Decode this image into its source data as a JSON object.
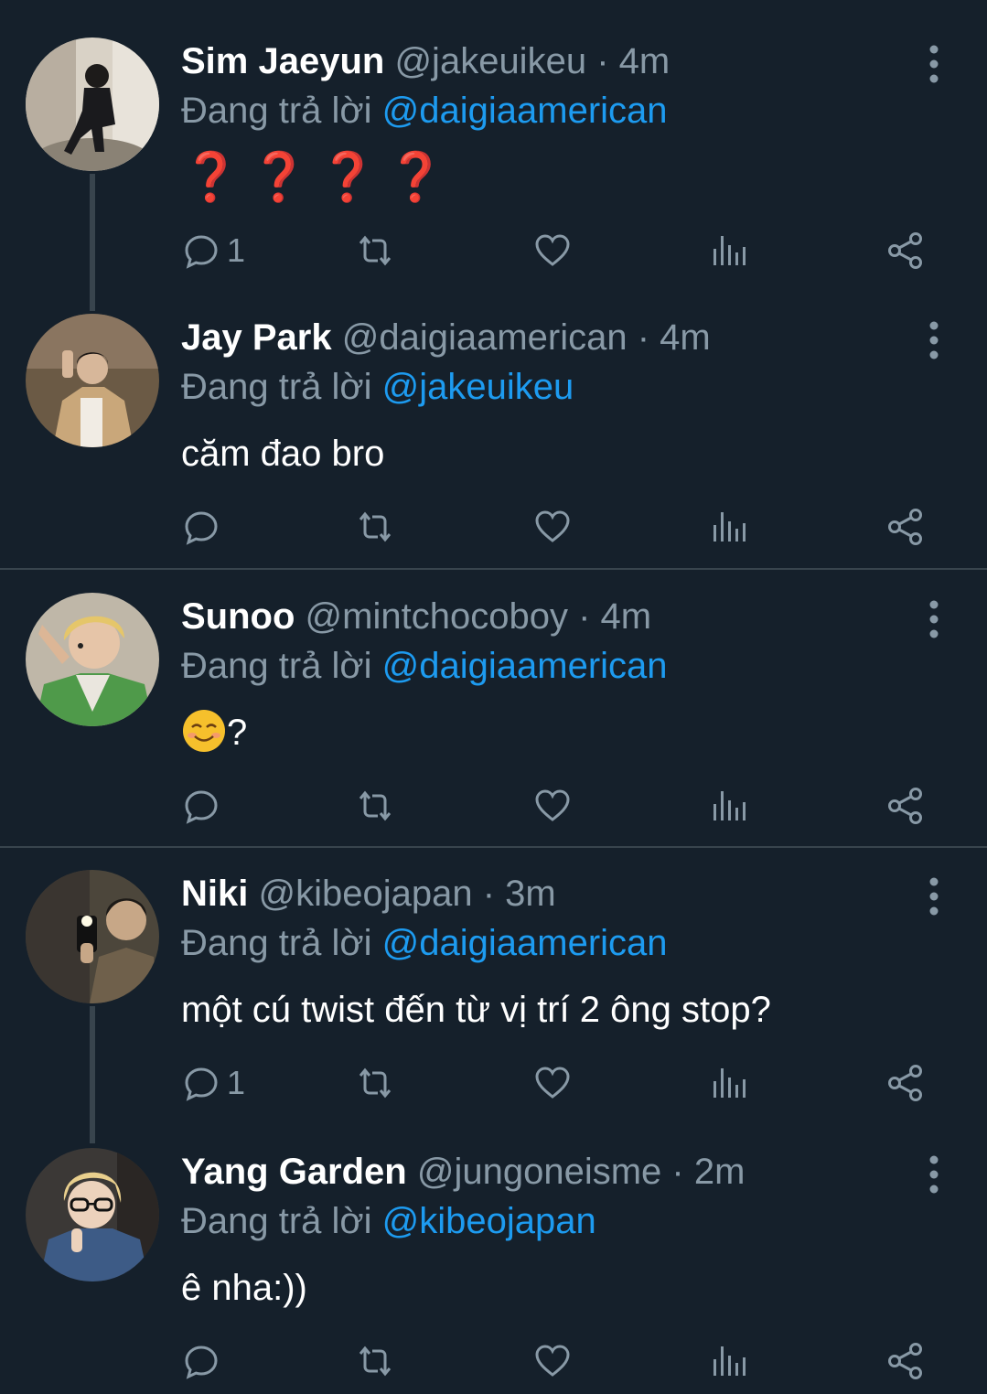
{
  "tweets": [
    {
      "name": "Sim Jaeyun",
      "handle": "@jakeuikeu",
      "dot": "·",
      "time": "4m",
      "reply_prefix": "Đang trả lời",
      "reply_to": "@daigiaamerican",
      "text": "❓❓❓❓",
      "reply_count": "1",
      "icons": [
        "more-icon",
        "reply-icon",
        "retweet-icon",
        "like-icon",
        "analytics-icon",
        "share-icon"
      ]
    },
    {
      "name": "Jay Park",
      "handle": "@daigiaamerican",
      "dot": "·",
      "time": "4m",
      "reply_prefix": "Đang trả lời",
      "reply_to": "@jakeuikeu",
      "text": "căm đao bro",
      "reply_count": ""
    },
    {
      "name": "Sunoo",
      "handle": "@mintchocoboy",
      "dot": "·",
      "time": "4m",
      "reply_prefix": "Đang trả lời",
      "reply_to": "@daigiaamerican",
      "text": "?",
      "reply_count": ""
    },
    {
      "name": "Niki",
      "handle": "@kibeojapan",
      "dot": "·",
      "time": "3m",
      "reply_prefix": "Đang trả lời",
      "reply_to": "@daigiaamerican",
      "text": "một cú twist đến từ vị trí 2 ông stop?",
      "reply_count": "1"
    },
    {
      "name": "Yang Garden",
      "handle": "@jungoneisme",
      "dot": "·",
      "time": "2m",
      "reply_prefix": "Đang trả lời",
      "reply_to": "@kibeojapan",
      "text": "ê nha:))",
      "reply_count": ""
    }
  ],
  "colors": {
    "background": "#15202b",
    "secondary_text": "#8899a6",
    "link": "#1d9bf0",
    "divider": "#38444d"
  }
}
